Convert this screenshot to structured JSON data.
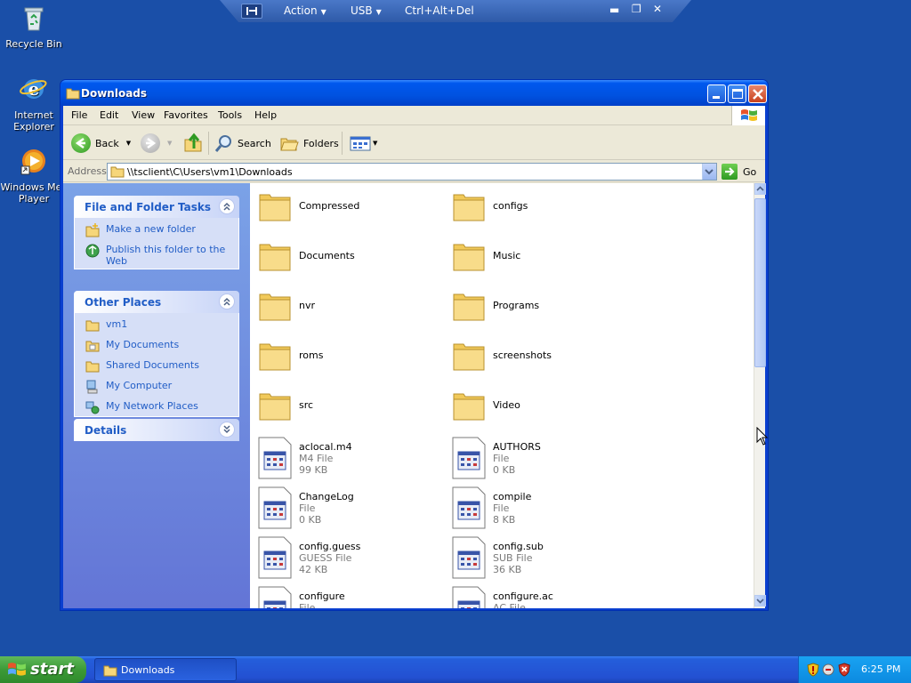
{
  "remote_bar": {
    "action": "Action",
    "usb": "USB",
    "cad": "Ctrl+Alt+Del"
  },
  "desktop": {
    "recycle_bin": "Recycle Bin",
    "ie_1": "Internet",
    "ie_2": "Explorer",
    "wmp_1": "Windows Mec",
    "wmp_2": "Player"
  },
  "window": {
    "title": "Downloads"
  },
  "menu": {
    "file": "File",
    "edit": "Edit",
    "view": "View",
    "favorites": "Favorites",
    "tools": "Tools",
    "help": "Help"
  },
  "toolbar": {
    "back": "Back",
    "search": "Search",
    "folders": "Folders"
  },
  "address": {
    "label": "Address",
    "path": "\\\\tsclient\\C\\Users\\vm1\\Downloads",
    "go": "Go"
  },
  "tasks": {
    "title": "File and Folder Tasks",
    "make_folder": "Make a new folder",
    "publish_1": "Publish this folder to the",
    "publish_2": "Web"
  },
  "other_places": {
    "title": "Other Places",
    "items": [
      "vm1",
      "My Documents",
      "Shared Documents",
      "My Computer",
      "My Network Places"
    ]
  },
  "details": {
    "title": "Details"
  },
  "folders": [
    "Compressed",
    "configs",
    "Documents",
    "Music",
    "nvr",
    "Programs",
    "roms",
    "screenshots",
    "src",
    "Video"
  ],
  "files": [
    {
      "name": "aclocal.m4",
      "type": "M4 File",
      "size": "99 KB"
    },
    {
      "name": "AUTHORS",
      "type": "File",
      "size": "0 KB"
    },
    {
      "name": "ChangeLog",
      "type": "File",
      "size": "0 KB"
    },
    {
      "name": "compile",
      "type": "File",
      "size": "8 KB"
    },
    {
      "name": "config.guess",
      "type": "GUESS File",
      "size": "42 KB"
    },
    {
      "name": "config.sub",
      "type": "SUB File",
      "size": "36 KB"
    },
    {
      "name": "configure",
      "type": "File",
      "size": ""
    },
    {
      "name": "configure.ac",
      "type": "AC File",
      "size": ""
    }
  ],
  "taskbar": {
    "start": "start",
    "task": "Downloads",
    "clock": "6:25 PM"
  }
}
